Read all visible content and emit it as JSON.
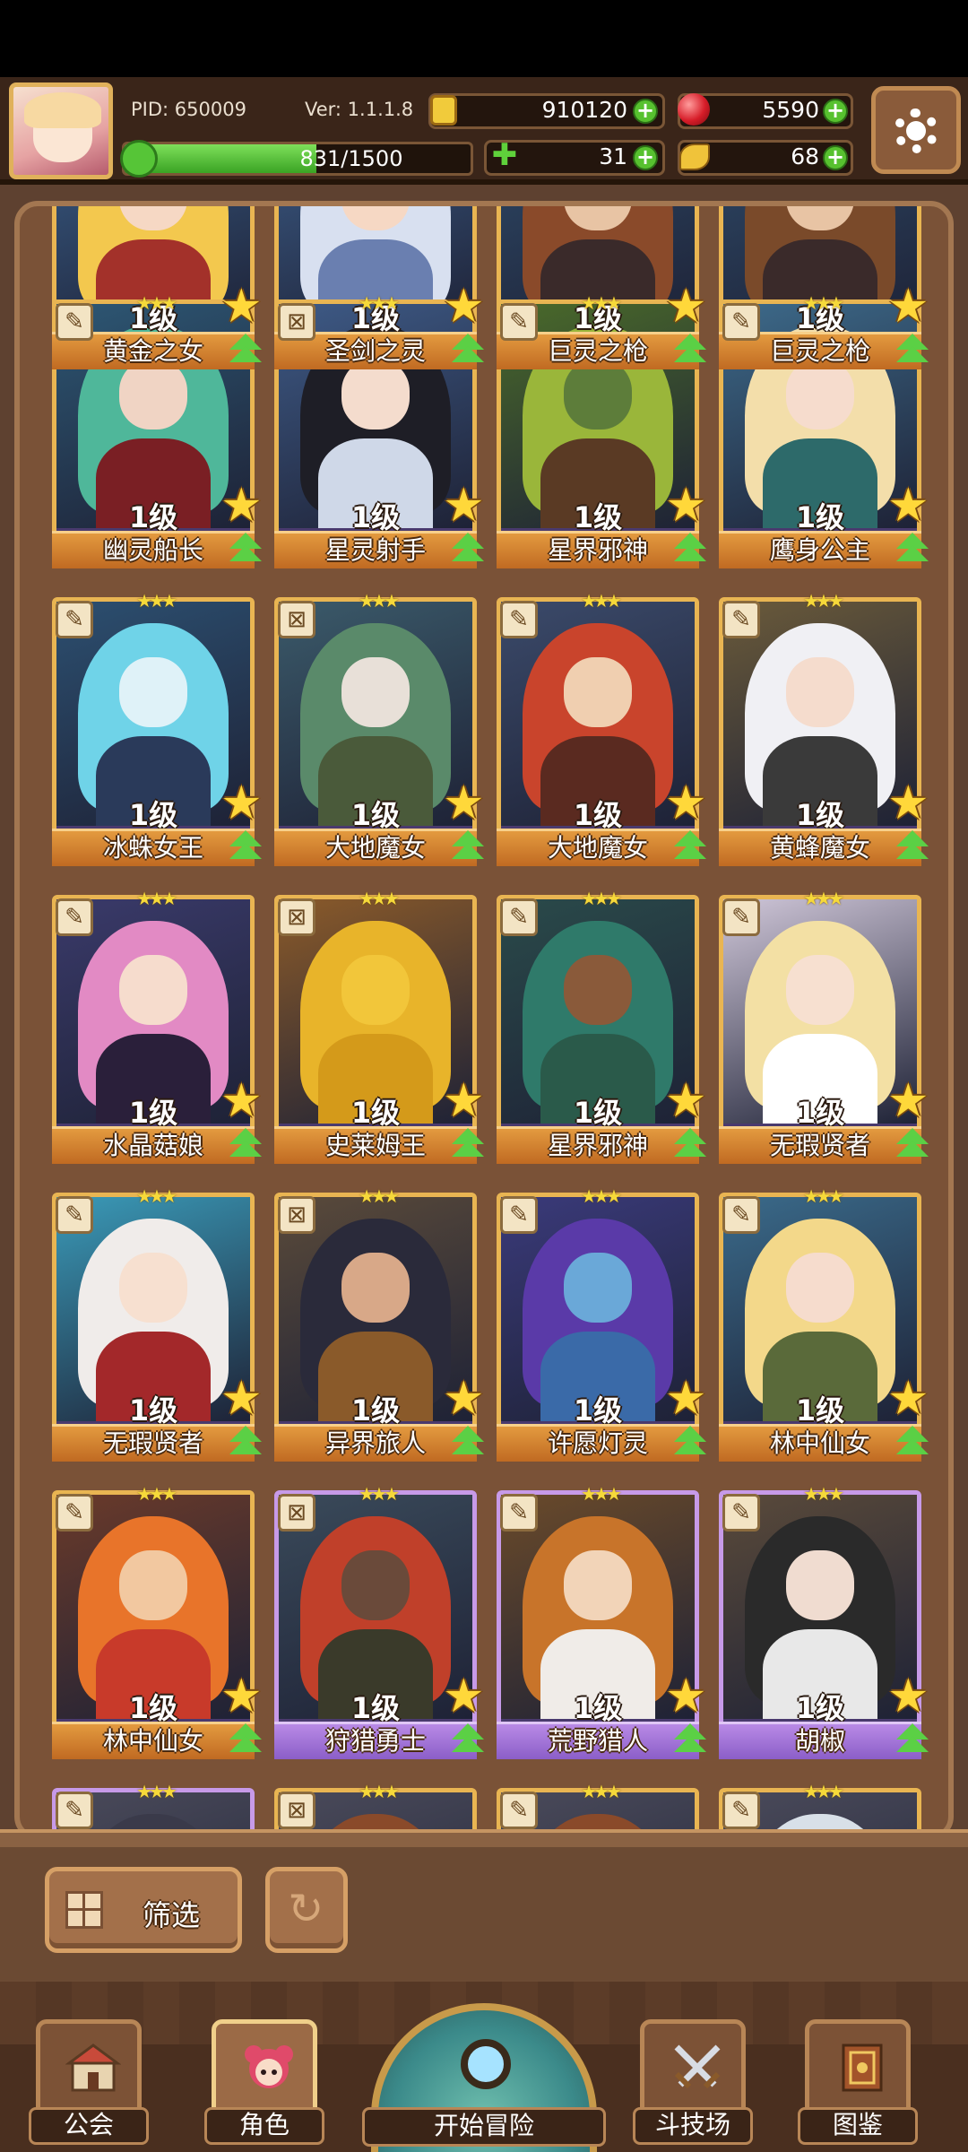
{
  "player": {
    "pid_label": "PID: 650009",
    "version_label": "Ver: 1.1.1.8",
    "xp_text": "831/1500",
    "xp_fraction": 0.554
  },
  "currencies": {
    "gold": "910120",
    "gems": "5590",
    "clover": "31",
    "item": "68"
  },
  "cards": [
    {
      "name": "黄金之女",
      "level": "1级",
      "frame": "gold",
      "colors": [
        "#3a5f8a",
        "#f3c84e",
        "#f6d8c4",
        "#a3312a"
      ]
    },
    {
      "name": "圣剑之灵",
      "level": "1级",
      "frame": "gold",
      "colors": [
        "#3d5e8a",
        "#d8e0f0",
        "#f6d8c4",
        "#6a7fb0"
      ]
    },
    {
      "name": "巨灵之枪",
      "level": "1级",
      "frame": "gold",
      "colors": [
        "#2f4c6b",
        "#8a4a2a",
        "#e8c4a4",
        "#3a2a2a"
      ]
    },
    {
      "name": "巨灵之枪",
      "level": "1级",
      "frame": "gold",
      "colors": [
        "#2f4c6b",
        "#7a4a2a",
        "#e8c4a4",
        "#3a2a2a"
      ]
    },
    {
      "name": "幽灵船长",
      "level": "1级",
      "frame": "gold",
      "colors": [
        "#2d5774",
        "#4fb79a",
        "#f0d4c4",
        "#7a1f24"
      ]
    },
    {
      "name": "星灵射手",
      "level": "1级",
      "frame": "gold",
      "colors": [
        "#3e5a86",
        "#1e1e26",
        "#f4dccd",
        "#cfd8e8"
      ]
    },
    {
      "name": "星界邪神",
      "level": "1级",
      "frame": "gold",
      "colors": [
        "#4a6a2a",
        "#9ab63a",
        "#5d7d3a",
        "#5a3a24"
      ]
    },
    {
      "name": "鹰身公主",
      "level": "1级",
      "frame": "gold",
      "colors": [
        "#3d6a8a",
        "#f3deaa",
        "#f6dccd",
        "#2d6a6a"
      ]
    },
    {
      "name": "冰蛛女王",
      "level": "1级",
      "frame": "gold",
      "colors": [
        "#2c4f70",
        "#6fd3e8",
        "#dff2f8",
        "#2a3a5a"
      ]
    },
    {
      "name": "大地魔女",
      "level": "1级",
      "frame": "gold",
      "colors": [
        "#3b5a6a",
        "#5a8a6a",
        "#e8e0d8",
        "#4a5a3a"
      ]
    },
    {
      "name": "大地魔女",
      "level": "1级",
      "frame": "gold",
      "colors": [
        "#3b4a6a",
        "#c9442c",
        "#f0cfb0",
        "#5a2a20"
      ]
    },
    {
      "name": "黄蜂魔女",
      "level": "1级",
      "frame": "gold",
      "colors": [
        "#6a5a3a",
        "#f0f0f4",
        "#f5dccd",
        "#3a3a3a"
      ]
    },
    {
      "name": "水晶菇娘",
      "level": "1级",
      "frame": "gold",
      "colors": [
        "#3a3a6a",
        "#e28ac4",
        "#f6dccd",
        "#2a1f3a"
      ]
    },
    {
      "name": "史莱姆王",
      "level": "1级",
      "frame": "gold",
      "colors": [
        "#8a5a2a",
        "#e8b42a",
        "#f2c63a",
        "#d49a1a"
      ]
    },
    {
      "name": "星界邪神",
      "level": "1级",
      "frame": "gold",
      "colors": [
        "#2a4a4a",
        "#2f7a6a",
        "#8a5a3a",
        "#2a5a4a"
      ]
    },
    {
      "name": "无瑕贤者",
      "level": "1级",
      "frame": "gold",
      "colors": [
        "#cfc6d8",
        "#f3e0a4",
        "#f7e0d0",
        "#ffffff"
      ]
    },
    {
      "name": "无瑕贤者",
      "level": "1级",
      "frame": "gold",
      "colors": [
        "#3a9ab8",
        "#f0ecea",
        "#f7e0d0",
        "#a3282a"
      ]
    },
    {
      "name": "异界旅人",
      "level": "1级",
      "frame": "gold",
      "colors": [
        "#5a4a3a",
        "#2a2a3a",
        "#d8a888",
        "#8a5a2a"
      ]
    },
    {
      "name": "许愿灯灵",
      "level": "1级",
      "frame": "gold",
      "colors": [
        "#3a3a7a",
        "#5a3aa8",
        "#6aa8d8",
        "#3a6aa8"
      ]
    },
    {
      "name": "林中仙女",
      "level": "1级",
      "frame": "gold",
      "colors": [
        "#3a6a8a",
        "#f3d88a",
        "#f6dccd",
        "#5a6a3a"
      ]
    },
    {
      "name": "林中仙女",
      "level": "1级",
      "frame": "gold",
      "colors": [
        "#6a3a2a",
        "#e8742a",
        "#f2c8a0",
        "#c83a2a"
      ]
    },
    {
      "name": "狩猎勇士",
      "level": "1级",
      "frame": "purple",
      "colors": [
        "#3a4a5a",
        "#c0402a",
        "#6a4a3a",
        "#3a3a2a"
      ]
    },
    {
      "name": "荒野猎人",
      "level": "1级",
      "frame": "purple",
      "colors": [
        "#6a4a2a",
        "#c8742a",
        "#f2d4b8",
        "#f0ece8"
      ]
    },
    {
      "name": "胡椒",
      "level": "1级",
      "frame": "purple",
      "colors": [
        "#5a4a3a",
        "#2a2a2a",
        "#f0dcd0",
        "#e8e8e8"
      ]
    },
    {
      "name": "",
      "level": "",
      "frame": "purple",
      "colors": [
        "#4a4a5a",
        "#3a3a4a",
        "#e8d0c4",
        "#4a4a5a"
      ]
    },
    {
      "name": "",
      "level": "",
      "frame": "gold",
      "colors": [
        "#4a4a5a",
        "#8a4a2a",
        "#e8d0c4",
        "#4a4a5a"
      ]
    },
    {
      "name": "",
      "level": "",
      "frame": "gold",
      "colors": [
        "#4a4a5a",
        "#8a4a2a",
        "#e8d0c4",
        "#4a4a5a"
      ]
    },
    {
      "name": "",
      "level": "",
      "frame": "gold",
      "colors": [
        "#4a4a5a",
        "#d8e0e8",
        "#e8d0c4",
        "#4a4a5a"
      ]
    }
  ],
  "controls": {
    "filter_label": "筛选"
  },
  "nav": {
    "guild": "公会",
    "role": "角色",
    "adventure": "开始冒险",
    "arena": "斗技场",
    "codex": "图鉴"
  },
  "colors": {
    "gold_frame": "#e9b552",
    "purple_frame": "#c79ae8",
    "green_accent": "#5bd045"
  }
}
